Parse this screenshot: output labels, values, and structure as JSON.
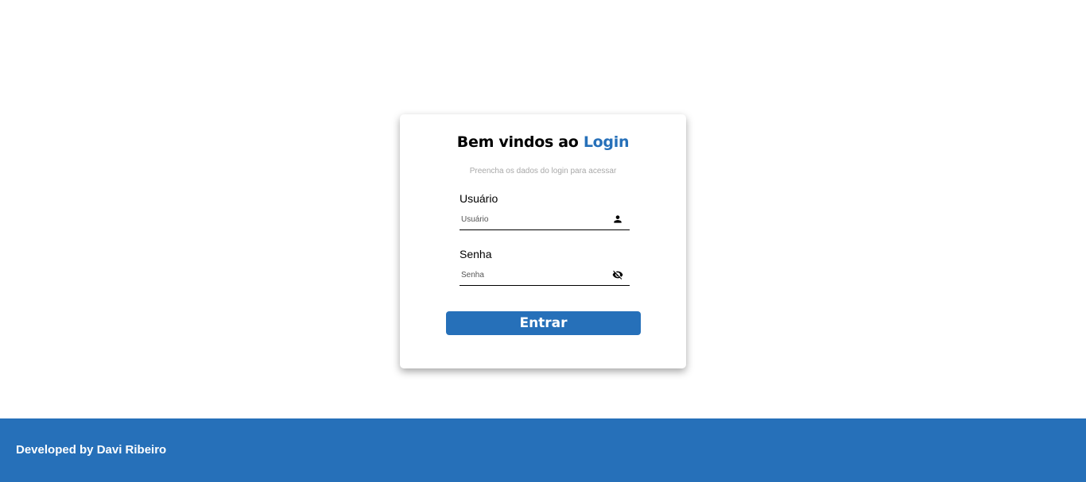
{
  "login": {
    "title_prefix": "Bem vindos ao ",
    "title_accent": "Login",
    "subtitle": "Preencha os dados do login para acessar",
    "user_label": "Usuário",
    "user_placeholder": "Usuário",
    "user_value": "",
    "user_icon": "person-icon",
    "password_label": "Senha",
    "password_placeholder": "Senha",
    "password_value": "",
    "password_icon": "eye-off-icon",
    "submit_label": "Entrar"
  },
  "footer": {
    "text": "Developed by Davi Ribeiro"
  },
  "colors": {
    "accent": "#2670b9",
    "background": "#ffffff",
    "subtitle": "#a8a8a8"
  }
}
